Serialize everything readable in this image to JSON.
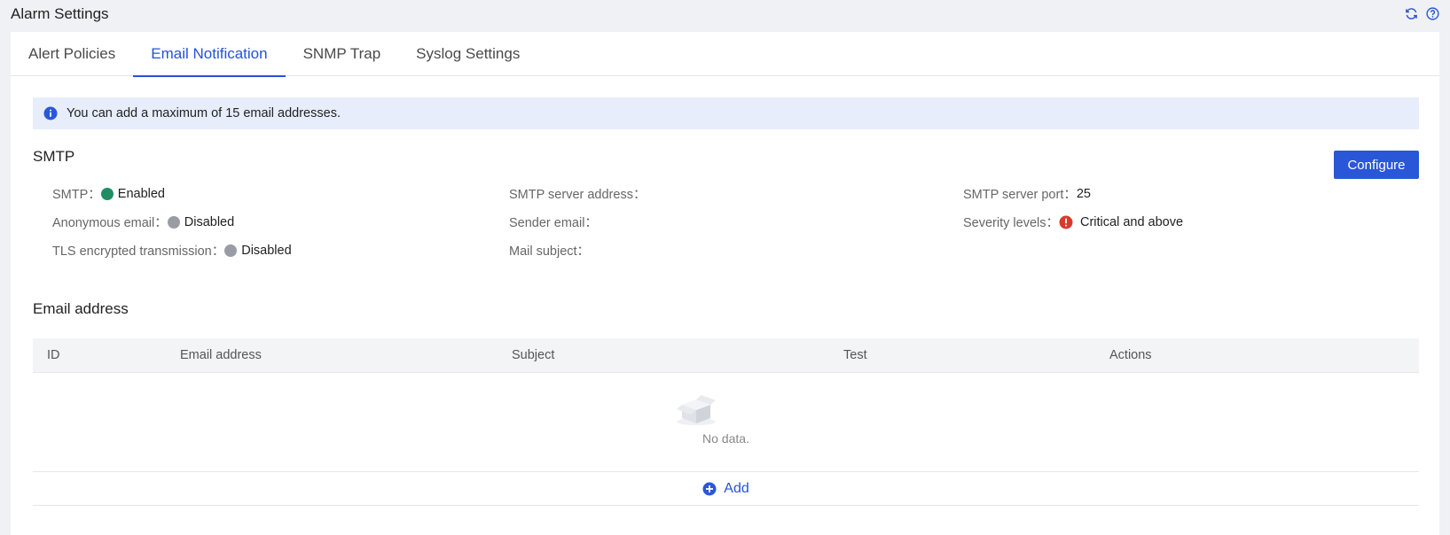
{
  "page": {
    "title": "Alarm Settings"
  },
  "header_icons": {
    "refresh": "refresh-icon",
    "help": "help-icon"
  },
  "tabs": [
    {
      "label": "Alert Policies",
      "active": false
    },
    {
      "label": "Email Notification",
      "active": true
    },
    {
      "label": "SNMP Trap",
      "active": false
    },
    {
      "label": "Syslog Settings",
      "active": false
    }
  ],
  "banner": {
    "text": "You can add a maximum of 15 email addresses."
  },
  "smtp": {
    "title": "SMTP",
    "configure_label": "Configure",
    "fields": {
      "smtp": {
        "key": "SMTP：",
        "value": "Enabled",
        "status_color": "#1f8f63"
      },
      "anonymous": {
        "key": "Anonymous email：",
        "value": "Disabled",
        "status_color": "#9a9ca3"
      },
      "tls": {
        "key": "TLS encrypted transmission：",
        "value": "Disabled",
        "status_color": "#9a9ca3"
      },
      "server_address": {
        "key": "SMTP server address：",
        "value": ""
      },
      "sender_email": {
        "key": "Sender email：",
        "value": ""
      },
      "mail_subject": {
        "key": "Mail subject：",
        "value": ""
      },
      "server_port": {
        "key": "SMTP server port：",
        "value": "25"
      },
      "severity": {
        "key": "Severity levels：",
        "value": "Critical and above",
        "status_color": "#d93a2e"
      }
    }
  },
  "email": {
    "title": "Email address",
    "columns": [
      "ID",
      "Email address",
      "Subject",
      "Test",
      "Actions"
    ],
    "rows": [],
    "empty_text": "No data.",
    "add_label": "Add"
  },
  "colors": {
    "accent": "#2552d9",
    "banner_bg": "#e7edfa"
  }
}
